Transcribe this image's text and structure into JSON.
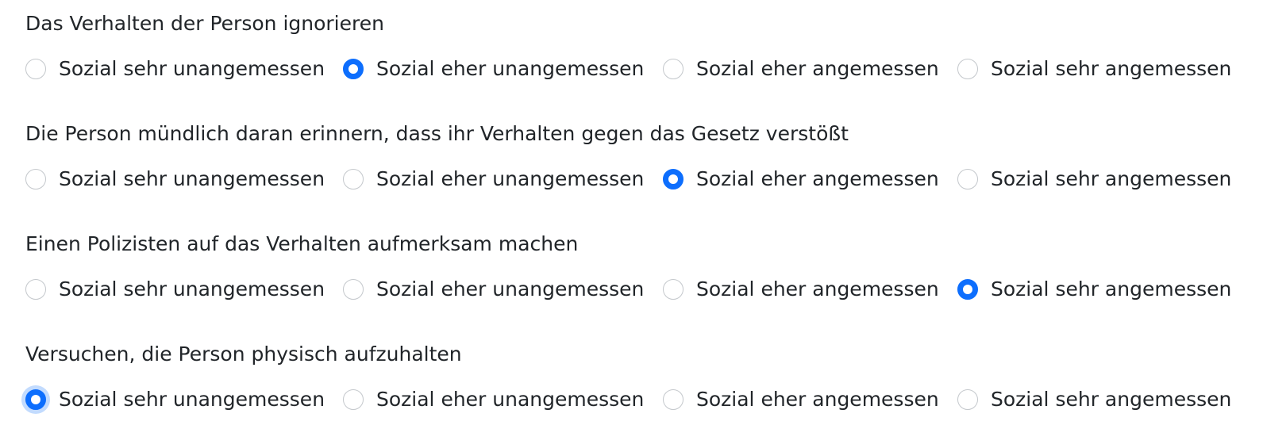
{
  "options": [
    "Sozial sehr unangemessen",
    "Sozial eher unangemessen",
    "Sozial eher angemessen",
    "Sozial sehr angemessen"
  ],
  "questions": [
    {
      "label": "Das Verhalten der Person ignorieren",
      "selected": 1
    },
    {
      "label": "Die Person mündlich daran erinnern, dass ihr Verhalten gegen das Gesetz verstößt",
      "selected": 2
    },
    {
      "label": "Einen Polizisten auf das Verhalten aufmerksam machen",
      "selected": 3
    },
    {
      "label": "Versuchen, die Person physisch aufzuhalten",
      "selected": 0,
      "focused": true
    }
  ],
  "colors": {
    "accent": "#0d6efd",
    "text": "#212529",
    "radio_border": "#c4c8cc"
  }
}
